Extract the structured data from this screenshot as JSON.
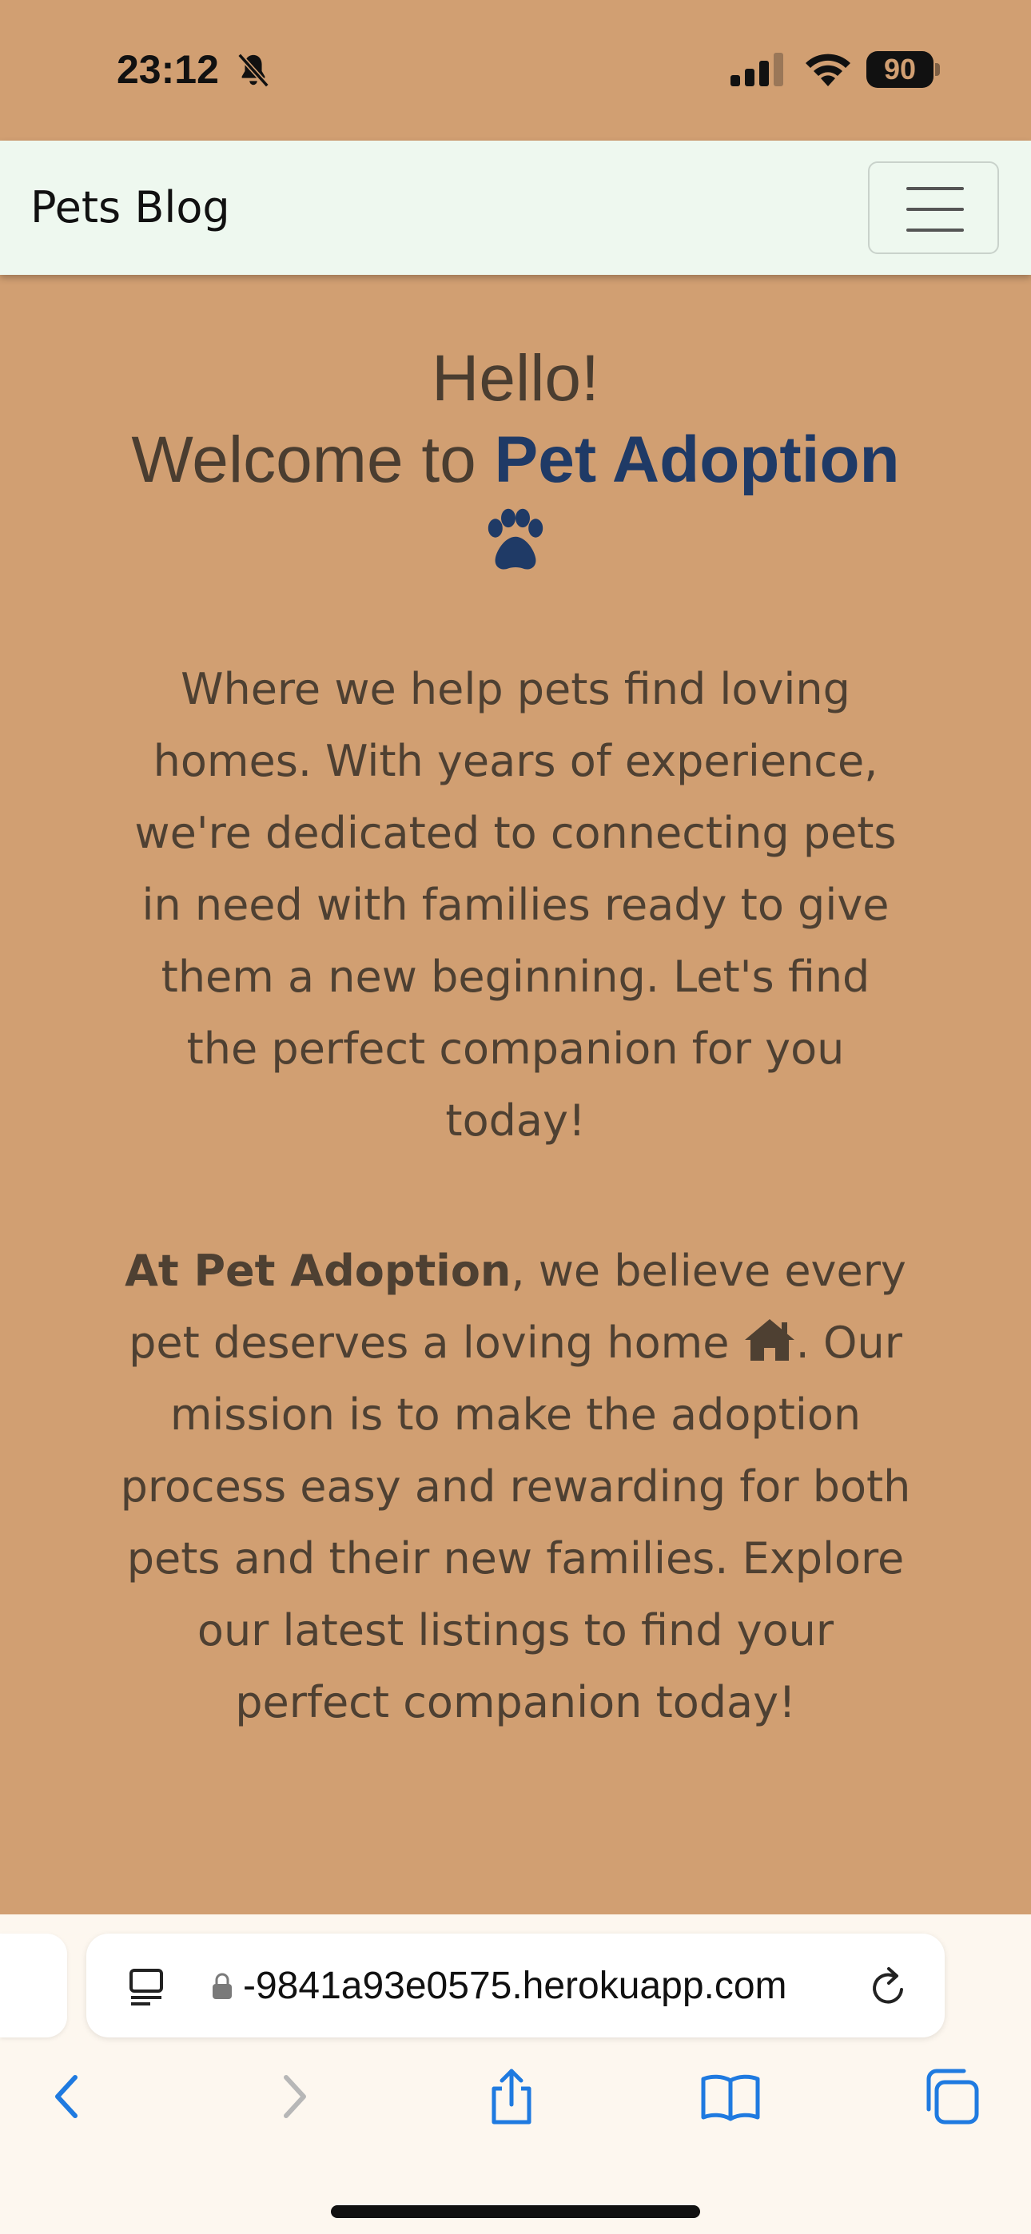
{
  "status_bar": {
    "time": "23:12",
    "battery": "90",
    "icons": [
      "bell-slash-icon",
      "signal-icon",
      "wifi-icon",
      "battery-icon"
    ]
  },
  "navbar": {
    "brand": "Pets Blog",
    "toggle_icon": "hamburger-icon"
  },
  "hero": {
    "greeting": "Hello!",
    "welcome_prefix": "Welcome to ",
    "welcome_brand": "Pet Adoption",
    "paw_icon": "paw-icon",
    "intro": "Where we help pets find loving homes. With years of experience, we're dedicated to connecting pets in need with families ready to give them a new beginning. Let's find the perfect companion for you today!",
    "mission_brand": "At Pet Adoption",
    "mission_part1": ", we believe every pet deserves a loving home ",
    "mission_part2": ". Our mission is to make the adoption process easy and rewarding for both pets and their new families. Explore our latest listings to find your perfect companion today!",
    "home_icon": "home-icon"
  },
  "browser": {
    "url": "-9841a93e0575.herokuapp.com",
    "icons": [
      "reader-icon",
      "lock-icon",
      "reload-icon"
    ],
    "toolbar": [
      "back-icon",
      "forward-icon",
      "share-icon",
      "bookmarks-icon",
      "tabs-icon"
    ]
  },
  "colors": {
    "page_background": "#d19f72",
    "navbar_background": "#eef8ef",
    "brand_accent": "#1f3a66",
    "text": "#4e4032"
  }
}
